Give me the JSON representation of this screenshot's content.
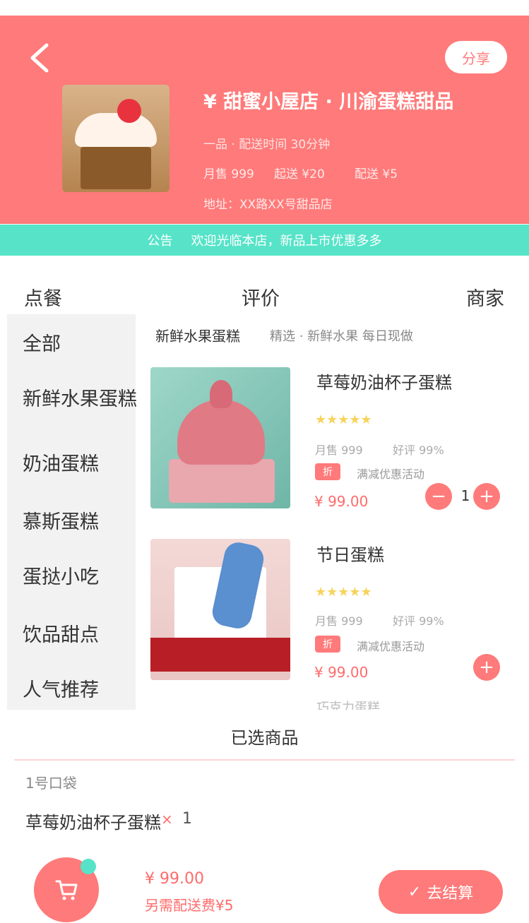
{
  "header": {
    "back_icon": "chevron-left-icon",
    "share_label": "分享",
    "shop_name": "¥ 甜蜜小屋店 · 川渝蛋糕甜品",
    "shop_sub": "一品 · 配送时间 30分钟",
    "stats": [
      "月售 999",
      "起送 ¥20",
      "配送 ¥5"
    ],
    "address": "地址：XX路XX号甜品店"
  },
  "notice": {
    "label": "公告",
    "text": "欢迎光临本店，新品上市优惠多多"
  },
  "tabs": [
    "点餐",
    "评价",
    "商家"
  ],
  "sidebar": {
    "items": [
      "全部",
      "新鲜水果蛋糕",
      "奶油蛋糕",
      "慕斯蛋糕",
      "蛋挞小吃",
      "饮品甜点",
      "人气推荐"
    ]
  },
  "category": {
    "title": "新鲜水果蛋糕",
    "desc": "精选 · 新鲜水果 每日现做"
  },
  "products": [
    {
      "name": "草莓奶油杯子蛋糕",
      "rating": 4.8,
      "stars": "★★★★★",
      "meta1": "月售 999",
      "meta2": "好评 99%",
      "badge": "折",
      "promo": "满减优惠活动",
      "price": "¥ 99.00",
      "qty": "1",
      "minus": "−",
      "plus": "+"
    },
    {
      "name": "节日蛋糕",
      "rating": 4.8,
      "stars": "★★★★★",
      "meta1": "月售 999",
      "meta2": "好评 99%",
      "badge": "折",
      "promo": "满减优惠活动",
      "price": "¥ 99.00",
      "plus": "+"
    }
  ],
  "peek_text": "巧克力蛋糕",
  "cart_panel": {
    "title": "已选商品",
    "section": "1号口袋",
    "item_name": "草莓奶油杯子蛋糕",
    "item_x": "×",
    "item_qty": "1"
  },
  "bottom_bar": {
    "cart_icon": "shopping-cart-icon",
    "total": "¥ 99.00",
    "fee": "另需配送费¥5",
    "checkout_icon": "check-icon",
    "checkout_label": "去结算"
  },
  "colors": {
    "brand": "#ff7a7a",
    "accent": "#56e3c8",
    "price": "#ff6b6b",
    "star": "#f7d35c"
  }
}
